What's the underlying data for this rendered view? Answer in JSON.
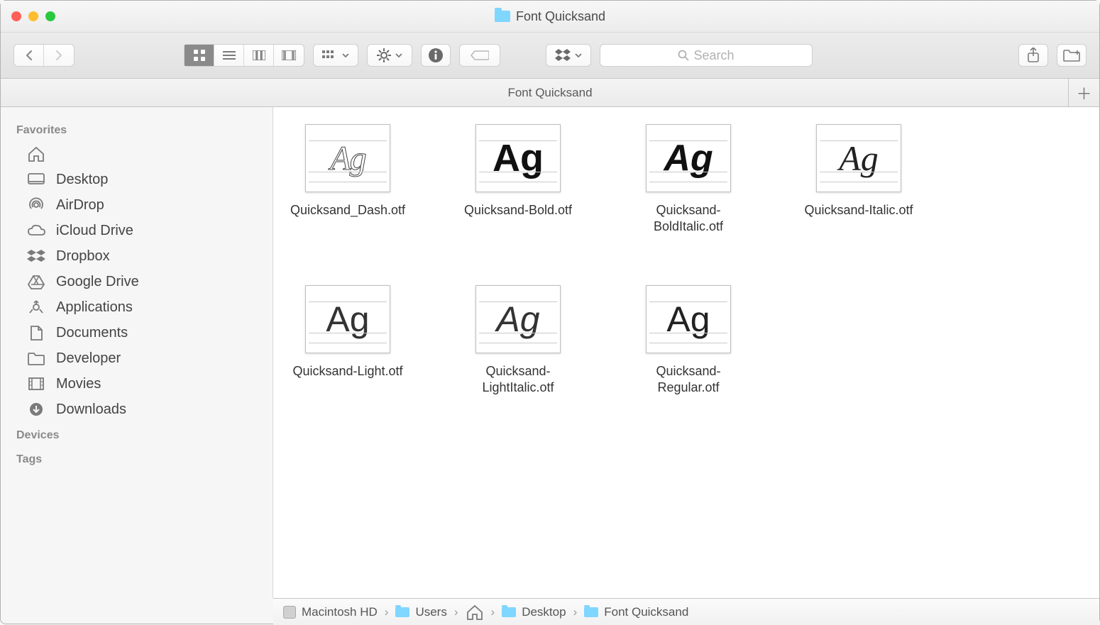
{
  "window": {
    "title": "Font Quicksand"
  },
  "toolbar": {
    "search_placeholder": "Search"
  },
  "tab": {
    "label": "Font Quicksand"
  },
  "sidebar": {
    "sections": [
      {
        "title": "Favorites",
        "items": [
          {
            "icon": "home",
            "label": ""
          },
          {
            "icon": "desktop",
            "label": "Desktop"
          },
          {
            "icon": "airdrop",
            "label": "AirDrop"
          },
          {
            "icon": "cloud",
            "label": "iCloud Drive"
          },
          {
            "icon": "dropbox",
            "label": "Dropbox"
          },
          {
            "icon": "gdrive",
            "label": "Google Drive"
          },
          {
            "icon": "apps",
            "label": "Applications"
          },
          {
            "icon": "documents",
            "label": "Documents"
          },
          {
            "icon": "folder",
            "label": "Developer"
          },
          {
            "icon": "movies",
            "label": "Movies"
          },
          {
            "icon": "downloads",
            "label": "Downloads"
          }
        ]
      },
      {
        "title": "Devices",
        "items": []
      },
      {
        "title": "Tags",
        "items": []
      }
    ]
  },
  "files": [
    {
      "name": "Quicksand_Dash.otf",
      "style": "dash"
    },
    {
      "name": "Quicksand-Bold.otf",
      "style": "bold"
    },
    {
      "name": "Quicksand-BoldItalic.otf",
      "style": "bolditalic"
    },
    {
      "name": "Quicksand-Italic.otf",
      "style": "italic"
    },
    {
      "name": "Quicksand-Light.otf",
      "style": "light"
    },
    {
      "name": "Quicksand-LightItalic.otf",
      "style": "lightitalic"
    },
    {
      "name": "Quicksand-Regular.otf",
      "style": "regular"
    }
  ],
  "path": [
    {
      "icon": "hd",
      "label": "Macintosh HD"
    },
    {
      "icon": "folder",
      "label": "Users"
    },
    {
      "icon": "home",
      "label": ""
    },
    {
      "icon": "folder",
      "label": "Desktop"
    },
    {
      "icon": "folder",
      "label": "Font Quicksand"
    }
  ]
}
